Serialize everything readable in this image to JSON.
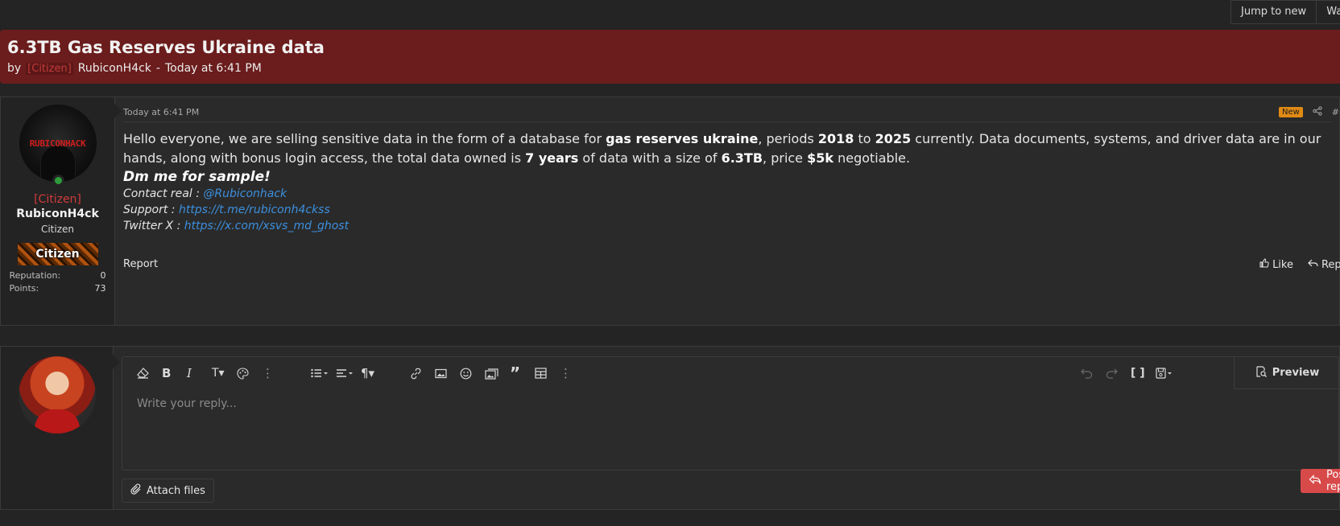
{
  "top_actions": {
    "jump_label": "Jump to new",
    "watch_label": "Watch"
  },
  "thread": {
    "title": "6.3TB Gas Reserves Ukraine data",
    "by_label": "by",
    "author_tag": "[Citizen]",
    "author": "RubiconH4ck",
    "separator": "-",
    "date": "Today at 6:41 PM"
  },
  "post": {
    "date": "Today at 6:41 PM",
    "badge": "New",
    "hash": "#",
    "user": {
      "avatar_text": "RUBICONHACK",
      "rank_tag": "[Citizen]",
      "name": "RubiconH4ck",
      "title": "Citizen",
      "banner": "Citizen",
      "stats": [
        {
          "label": "Reputation:",
          "value": "0"
        },
        {
          "label": "Points:",
          "value": "73"
        }
      ]
    },
    "body": {
      "t1": "Hello everyone, we are selling sensitive data in the form of a database for ",
      "b1": "gas reserves ukraine",
      "t2": ", periods ",
      "b2": "2018",
      "t3": " to ",
      "b3": "2025",
      "t4": " currently. Data documents, systems, and driver data are in our hands, along with bonus login access, the total data owned is ",
      "b4": "7 years",
      "t5": " of data with a size of ",
      "b5": "6.3TB",
      "t6": ", price ",
      "b6": "$5k",
      "t7": " negotiable."
    },
    "dm_line": "Dm me for sample!",
    "contacts": [
      {
        "label": "Contact real : ",
        "value": "@Rubiconhack"
      },
      {
        "label": "Support : ",
        "value": "https://t.me/rubiconh4ckss"
      },
      {
        "label": "Twitter X : ",
        "value": "https://x.com/xsvs_md_ghost"
      }
    ],
    "footer": {
      "report": "Report",
      "like": "Like",
      "reply": "Reply"
    }
  },
  "reply_editor": {
    "placeholder": "Write your reply...",
    "preview_label": "Preview",
    "attach_label": "Attach files",
    "post_reply_label": "Post reply"
  }
}
